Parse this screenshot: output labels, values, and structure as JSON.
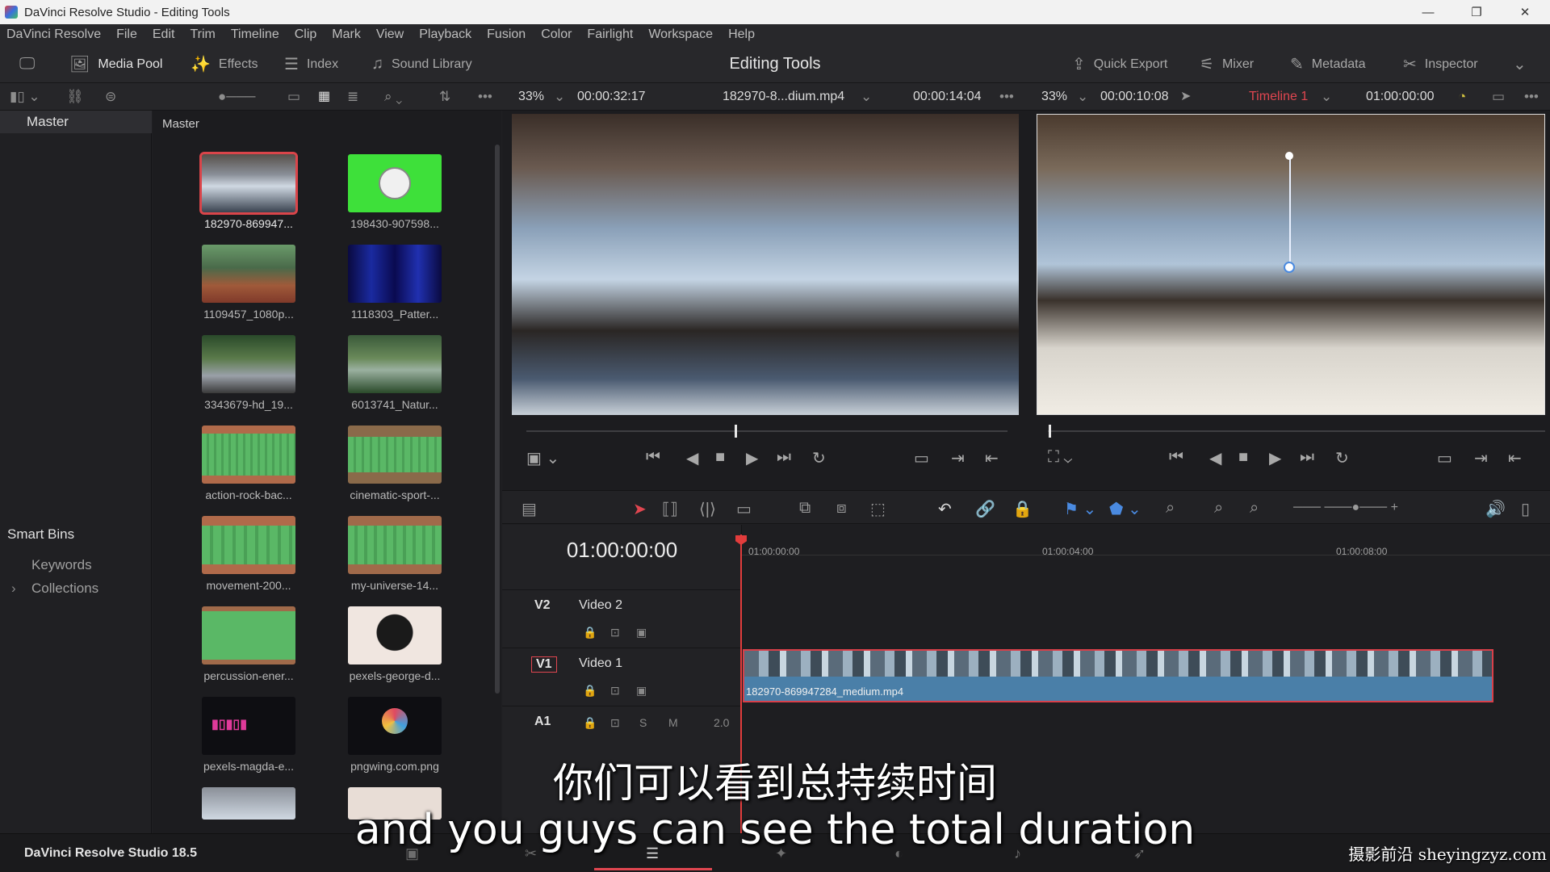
{
  "window": {
    "title": "DaVinci Resolve Studio - Editing Tools"
  },
  "menu": [
    "DaVinci Resolve",
    "File",
    "Edit",
    "Trim",
    "Timeline",
    "Clip",
    "Mark",
    "View",
    "Playback",
    "Fusion",
    "Color",
    "Fairlight",
    "Workspace",
    "Help"
  ],
  "toolbar": {
    "media_pool": "Media Pool",
    "effects": "Effects",
    "index": "Index",
    "sound_library": "Sound Library",
    "page_title": "Editing Tools",
    "quick_export": "Quick Export",
    "mixer": "Mixer",
    "metadata": "Metadata",
    "inspector": "Inspector"
  },
  "source_viewer": {
    "zoom": "33%",
    "duration": "00:00:32:17",
    "clip_name": "182970-8...dium.mp4",
    "timecode": "00:00:14:04"
  },
  "timeline_viewer": {
    "zoom": "33%",
    "duration": "00:00:10:08",
    "timeline_name": "Timeline 1",
    "timecode": "01:00:00:00"
  },
  "bins": {
    "master": "Master",
    "smart_bins": "Smart Bins",
    "keywords": "Keywords",
    "collections": "Collections"
  },
  "pool": {
    "header": "Master",
    "clips": [
      {
        "name": "182970-869947...",
        "kind": "video-water",
        "selected": true
      },
      {
        "name": "198430-907598...",
        "kind": "clock-green"
      },
      {
        "name": "1109457_1080p...",
        "kind": "video-court"
      },
      {
        "name": "1118303_Patter...",
        "kind": "video-blue"
      },
      {
        "name": "3343679-hd_19...",
        "kind": "video-forest"
      },
      {
        "name": "6013741_Natur...",
        "kind": "video-nature"
      },
      {
        "name": "action-rock-bac...",
        "kind": "audio"
      },
      {
        "name": "cinematic-sport-...",
        "kind": "audio"
      },
      {
        "name": "movement-200...",
        "kind": "audio"
      },
      {
        "name": "my-universe-14...",
        "kind": "audio"
      },
      {
        "name": "percussion-ener...",
        "kind": "audio"
      },
      {
        "name": "pexels-george-d...",
        "kind": "image-flowers"
      },
      {
        "name": "pexels-magda-e...",
        "kind": "image-text"
      },
      {
        "name": "pngwing.com.png",
        "kind": "image-logo"
      }
    ]
  },
  "timeline": {
    "current_tc": "01:00:00:00",
    "ruler": [
      "01:00:00:00",
      "01:00:04:00",
      "01:00:08:00"
    ],
    "tracks": [
      {
        "id": "V2",
        "name": "Video 2"
      },
      {
        "id": "V1",
        "name": "Video 1"
      },
      {
        "id": "A1",
        "name": "",
        "level": "2.0"
      }
    ],
    "clip_name": "182970-869947284_medium.mp4"
  },
  "bottom": {
    "brand": "DaVinci Resolve Studio 18.5"
  },
  "subtitles": {
    "zh": "你们可以看到总持续时间",
    "en": "and you guys can see the total duration"
  },
  "watermark": "摄影前沿 sheyingzyz.com",
  "colors": {
    "accent_red": "#d9454a",
    "clip_blue": "#4a7fa8",
    "audio_green": "#5ab866"
  }
}
